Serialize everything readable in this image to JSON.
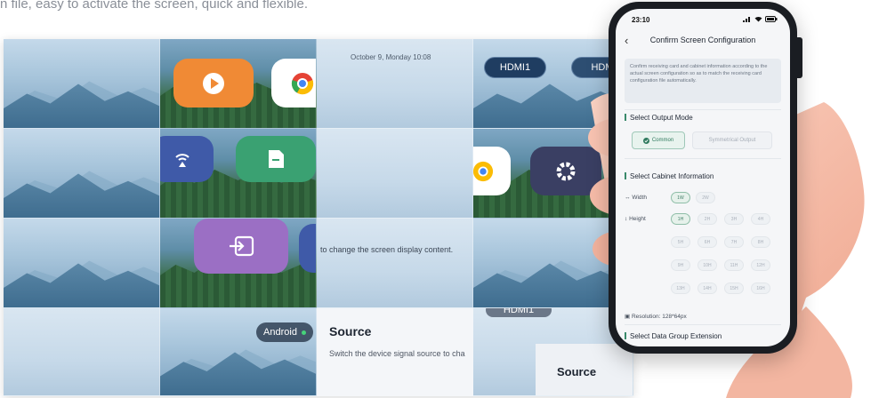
{
  "intro_text": "n file, easy to activate the screen, quick and flexible.",
  "wall": {
    "notification": "October 9, Monday 10:08",
    "hdmi1_label": "HDMI1",
    "hdmi2_label": "HDM",
    "hdmi3_label": "HDMI1",
    "display_hint": "to change the screen display content.",
    "android_label": "Android",
    "source_title": "Source",
    "source_desc": "Switch the device signal source to cha",
    "source_title_2": "Source"
  },
  "phone": {
    "time": "23:10",
    "title": "Confirm Screen Configuration",
    "info": "Confirm receiving card and cabinet information according to the actual screen configuration so as to match the receiving card configuration file automatically.",
    "output_mode_label": "Select Output Mode",
    "output_options": [
      "Common",
      "Symmetrical Output"
    ],
    "cabinet_label": "Select Cabinet Information",
    "width_label": "Width",
    "width_options": [
      "1W",
      "2W"
    ],
    "height_label": "Height",
    "height_options": [
      "1H",
      "2H",
      "3H",
      "4H",
      "5H",
      "6H",
      "7H",
      "8H",
      "9H",
      "10H",
      "11H",
      "12H",
      "13H",
      "14H",
      "15H",
      "16H"
    ],
    "resolution": "Resolution: 128*64px",
    "data_group_label": "Select Data Group Extension"
  },
  "colors": {
    "accent": "#3a8a6b",
    "orange_tile": "#f08a35",
    "green_tile": "#3aa172",
    "purple_tile": "#9b6fc4",
    "blue_tile": "#3f5aa8",
    "dark_tile": "#3a3f63"
  }
}
